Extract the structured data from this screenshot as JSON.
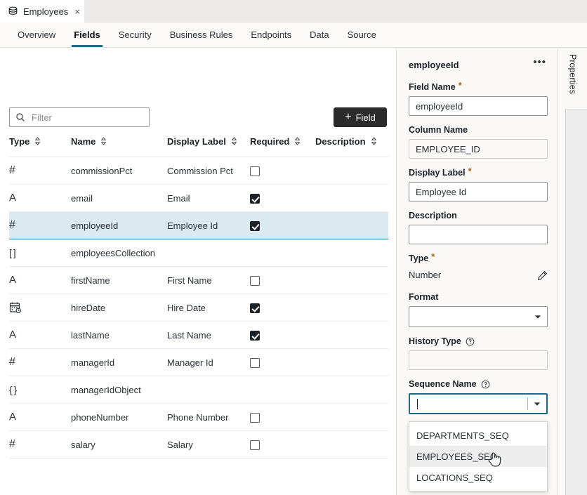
{
  "window": {
    "doc_tab": {
      "label": "Employees",
      "icon": "database-icon",
      "close": "×"
    }
  },
  "nav_tabs": [
    {
      "label": "Overview",
      "active": false
    },
    {
      "label": "Fields",
      "active": true
    },
    {
      "label": "Security",
      "active": false
    },
    {
      "label": "Business Rules",
      "active": false
    },
    {
      "label": "Endpoints",
      "active": false
    },
    {
      "label": "Data",
      "active": false
    },
    {
      "label": "Source",
      "active": false
    }
  ],
  "toolbar": {
    "filter_value": "",
    "filter_placeholder": "Filter",
    "filter_icon": "search-icon",
    "add_field_label": "Field",
    "add_field_plus": "+"
  },
  "table": {
    "columns": [
      {
        "label": "Type",
        "sortable": true
      },
      {
        "label": "Name",
        "sortable": true
      },
      {
        "label": "Display Label",
        "sortable": true
      },
      {
        "label": "Required",
        "sortable": true
      },
      {
        "label": "Description",
        "sortable": true
      }
    ],
    "rows": [
      {
        "type_icon": "number-hash-icon",
        "type_glyph": "#",
        "name": "commissionPct",
        "display_label": "Commission Pct",
        "required": false,
        "has_checkbox": true,
        "description": "",
        "selected": false
      },
      {
        "type_icon": "string-a-icon",
        "type_glyph": "A",
        "name": "email",
        "display_label": "Email",
        "required": true,
        "has_checkbox": true,
        "description": "",
        "selected": false
      },
      {
        "type_icon": "number-hash-icon",
        "type_glyph": "#",
        "name": "employeeId",
        "display_label": "Employee Id",
        "required": true,
        "has_checkbox": true,
        "description": "",
        "selected": true
      },
      {
        "type_icon": "array-icon",
        "type_glyph": "[ ]",
        "name": "employeesCollection",
        "display_label": "",
        "required": false,
        "has_checkbox": false,
        "description": "",
        "selected": false
      },
      {
        "type_icon": "string-a-icon",
        "type_glyph": "A",
        "name": "firstName",
        "display_label": "First Name",
        "required": false,
        "has_checkbox": true,
        "description": "",
        "selected": false
      },
      {
        "type_icon": "date-icon",
        "type_glyph": "",
        "name": "hireDate",
        "display_label": "Hire Date",
        "required": true,
        "has_checkbox": true,
        "description": "",
        "selected": false
      },
      {
        "type_icon": "string-a-icon",
        "type_glyph": "A",
        "name": "lastName",
        "display_label": "Last Name",
        "required": true,
        "has_checkbox": true,
        "description": "",
        "selected": false
      },
      {
        "type_icon": "number-hash-icon",
        "type_glyph": "#",
        "name": "managerId",
        "display_label": "Manager Id",
        "required": false,
        "has_checkbox": true,
        "description": "",
        "selected": false
      },
      {
        "type_icon": "object-icon",
        "type_glyph": "{ }",
        "name": "managerIdObject",
        "display_label": "",
        "required": false,
        "has_checkbox": false,
        "description": "",
        "selected": false
      },
      {
        "type_icon": "string-a-icon",
        "type_glyph": "A",
        "name": "phoneNumber",
        "display_label": "Phone Number",
        "required": false,
        "has_checkbox": true,
        "description": "",
        "selected": false
      },
      {
        "type_icon": "number-hash-icon",
        "type_glyph": "#",
        "name": "salary",
        "display_label": "Salary",
        "required": false,
        "has_checkbox": true,
        "description": "",
        "selected": false
      }
    ]
  },
  "properties": {
    "title": "employeeId",
    "more_menu": "•••",
    "fields": {
      "field_name": {
        "label": "Field Name",
        "required_marker": "*",
        "value": "employeeId"
      },
      "column_name": {
        "label": "Column Name",
        "value": "EMPLOYEE_ID"
      },
      "display_label": {
        "label": "Display Label",
        "required_marker": "*",
        "value": "Employee Id"
      },
      "description": {
        "label": "Description",
        "value": ""
      },
      "type": {
        "label": "Type",
        "required_marker": "*",
        "value": "Number",
        "edit_icon": "pencil-icon"
      },
      "format": {
        "label": "Format",
        "value": ""
      },
      "history_type": {
        "label": "History Type",
        "help_icon": "help-circle-icon",
        "value": ""
      },
      "sequence_name": {
        "label": "Sequence Name",
        "help_icon": "help-circle-icon",
        "value": ""
      }
    }
  },
  "sequence_dropdown": {
    "open": true,
    "options": [
      {
        "label": "DEPARTMENTS_SEQ",
        "hovered": false
      },
      {
        "label": "EMPLOYEES_SEQ",
        "hovered": true
      },
      {
        "label": "LOCATIONS_SEQ",
        "hovered": false
      }
    ]
  },
  "right_rail": {
    "label": "Properties"
  },
  "colors": {
    "accent_teal": "#1b6b86",
    "selected_row_bg": "#daeaf0",
    "selected_row_border": "#2a7d96",
    "button_dark": "#2b2b2b",
    "panel_bg": "#faf9f8",
    "required_star": "#a36a12"
  }
}
